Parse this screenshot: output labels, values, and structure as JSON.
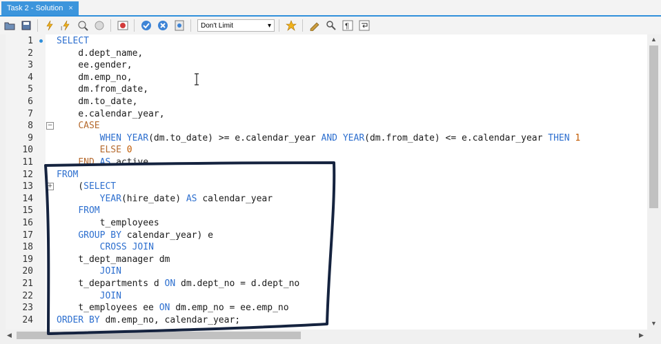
{
  "tab": {
    "title": "Task 2 - Solution",
    "close": "×"
  },
  "toolbar": {
    "icons": [
      "open-folder-icon",
      "save-icon",
      "execute-icon",
      "execute-current-icon",
      "explain-icon",
      "stop-icon",
      "toggle-continue-icon",
      "commit-icon",
      "rollback-icon",
      "autocommit-icon",
      "beautify-icon",
      "find-icon",
      "invisible-chars-icon",
      "wrap-icon",
      "bookmark-icon"
    ],
    "limit_value": "Don't Limit",
    "limit_arrow": "▾"
  },
  "editor": {
    "lines": [
      {
        "n": "1",
        "html": "<span class=\"kw\">SELECT</span>"
      },
      {
        "n": "2",
        "html": "    d.dept_name,"
      },
      {
        "n": "3",
        "html": "    ee.gender,"
      },
      {
        "n": "4",
        "html": "    dm.emp_no,"
      },
      {
        "n": "5",
        "html": "    dm.from_date,"
      },
      {
        "n": "6",
        "html": "    dm.to_date,"
      },
      {
        "n": "7",
        "html": "    e.calendar_year,"
      },
      {
        "n": "8",
        "html": "    <span class=\"ck\">CASE</span>"
      },
      {
        "n": "9",
        "html": "        <span class=\"kw\">WHEN</span> <span class=\"kw\">YEAR</span>(dm.to_date) >= e.calendar_year <span class=\"kw\">AND</span> <span class=\"kw\">YEAR</span>(dm.from_date) <= e.calendar_year <span class=\"kw\">THEN</span> <span class=\"num\">1</span>"
      },
      {
        "n": "10",
        "html": "        <span class=\"ck\">ELSE</span> <span class=\"num\">0</span>"
      },
      {
        "n": "11",
        "html": "    <span class=\"ck\">END</span> <span class=\"kw\">AS</span> active"
      },
      {
        "n": "12",
        "html": "<span class=\"kw\">FROM</span>"
      },
      {
        "n": "13",
        "html": "    (<span class=\"kw\">SELECT</span>"
      },
      {
        "n": "14",
        "html": "        <span class=\"kw\">YEAR</span>(hire_date) <span class=\"kw\">AS</span> calendar_year"
      },
      {
        "n": "15",
        "html": "    <span class=\"kw\">FROM</span>"
      },
      {
        "n": "16",
        "html": "        t_employees"
      },
      {
        "n": "17",
        "html": "    <span class=\"kw\">GROUP</span> <span class=\"kw\">BY</span> calendar_year) e"
      },
      {
        "n": "18",
        "html": "        <span class=\"kw\">CROSS</span> <span class=\"kw\">JOIN</span>"
      },
      {
        "n": "19",
        "html": "    t_dept_manager dm"
      },
      {
        "n": "20",
        "html": "        <span class=\"kw\">JOIN</span>"
      },
      {
        "n": "21",
        "html": "    t_departments d <span class=\"kw\">ON</span> dm.dept_no = d.dept_no"
      },
      {
        "n": "22",
        "html": "        <span class=\"kw\">JOIN</span>"
      },
      {
        "n": "23",
        "html": "    t_employees ee <span class=\"kw\">ON</span> dm.emp_no = ee.emp_no"
      },
      {
        "n": "24",
        "html": "<span class=\"kw\">ORDER</span> <span class=\"kw\">BY</span> dm.emp_no, calendar_year;"
      }
    ],
    "fold_lines": [
      "8",
      "13"
    ],
    "fold_symbols": {
      "8": "−",
      "13": "+"
    },
    "current_line": "1"
  },
  "scrollbars": {
    "up": "▲",
    "down": "▼",
    "left": "◀",
    "right": "▶"
  },
  "colors": {
    "accent": "#2f8fdb",
    "keyword": "#2d6fcf",
    "case_keyword": "#b56a2e",
    "number": "#c25a00",
    "ink": "#15233f"
  }
}
